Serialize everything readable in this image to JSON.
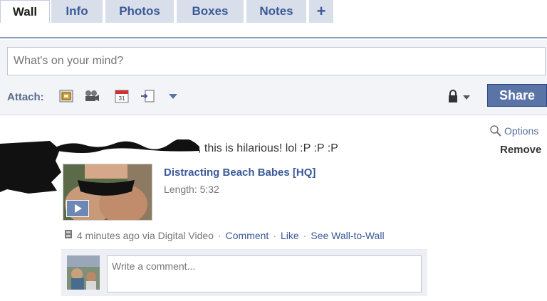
{
  "tabs": [
    {
      "label": "Wall",
      "active": true
    },
    {
      "label": "Info",
      "active": false
    },
    {
      "label": "Photos",
      "active": false
    },
    {
      "label": "Boxes",
      "active": false
    },
    {
      "label": "Notes",
      "active": false
    },
    {
      "label": "+",
      "active": false
    }
  ],
  "composer": {
    "placeholder": "What's on your mind?",
    "attach_label": "Attach:",
    "attach_icons": [
      "photo-icon",
      "video-icon",
      "event-icon",
      "link-icon",
      "more-dropdown-icon"
    ],
    "privacy_icon": "lock-icon",
    "share_label": "Share"
  },
  "story": {
    "text": ", this is hilarious! lol :P :P :P",
    "options_label": "Options",
    "remove_label": "Remove",
    "video": {
      "title": "Distracting Beach Babes [HQ]",
      "length": "Length: 5:32"
    },
    "meta": {
      "time_text": "4 minutes ago via Digital Video",
      "comment_label": "Comment",
      "like_label": "Like",
      "wall_to_wall_label": "See Wall-to-Wall"
    }
  },
  "comment": {
    "placeholder": "Write a comment..."
  },
  "colors": {
    "link": "#3b5998",
    "tab_bg": "#d8dfea",
    "share_button": "#5b74a8",
    "composer_bg": "#f2f4f8"
  }
}
